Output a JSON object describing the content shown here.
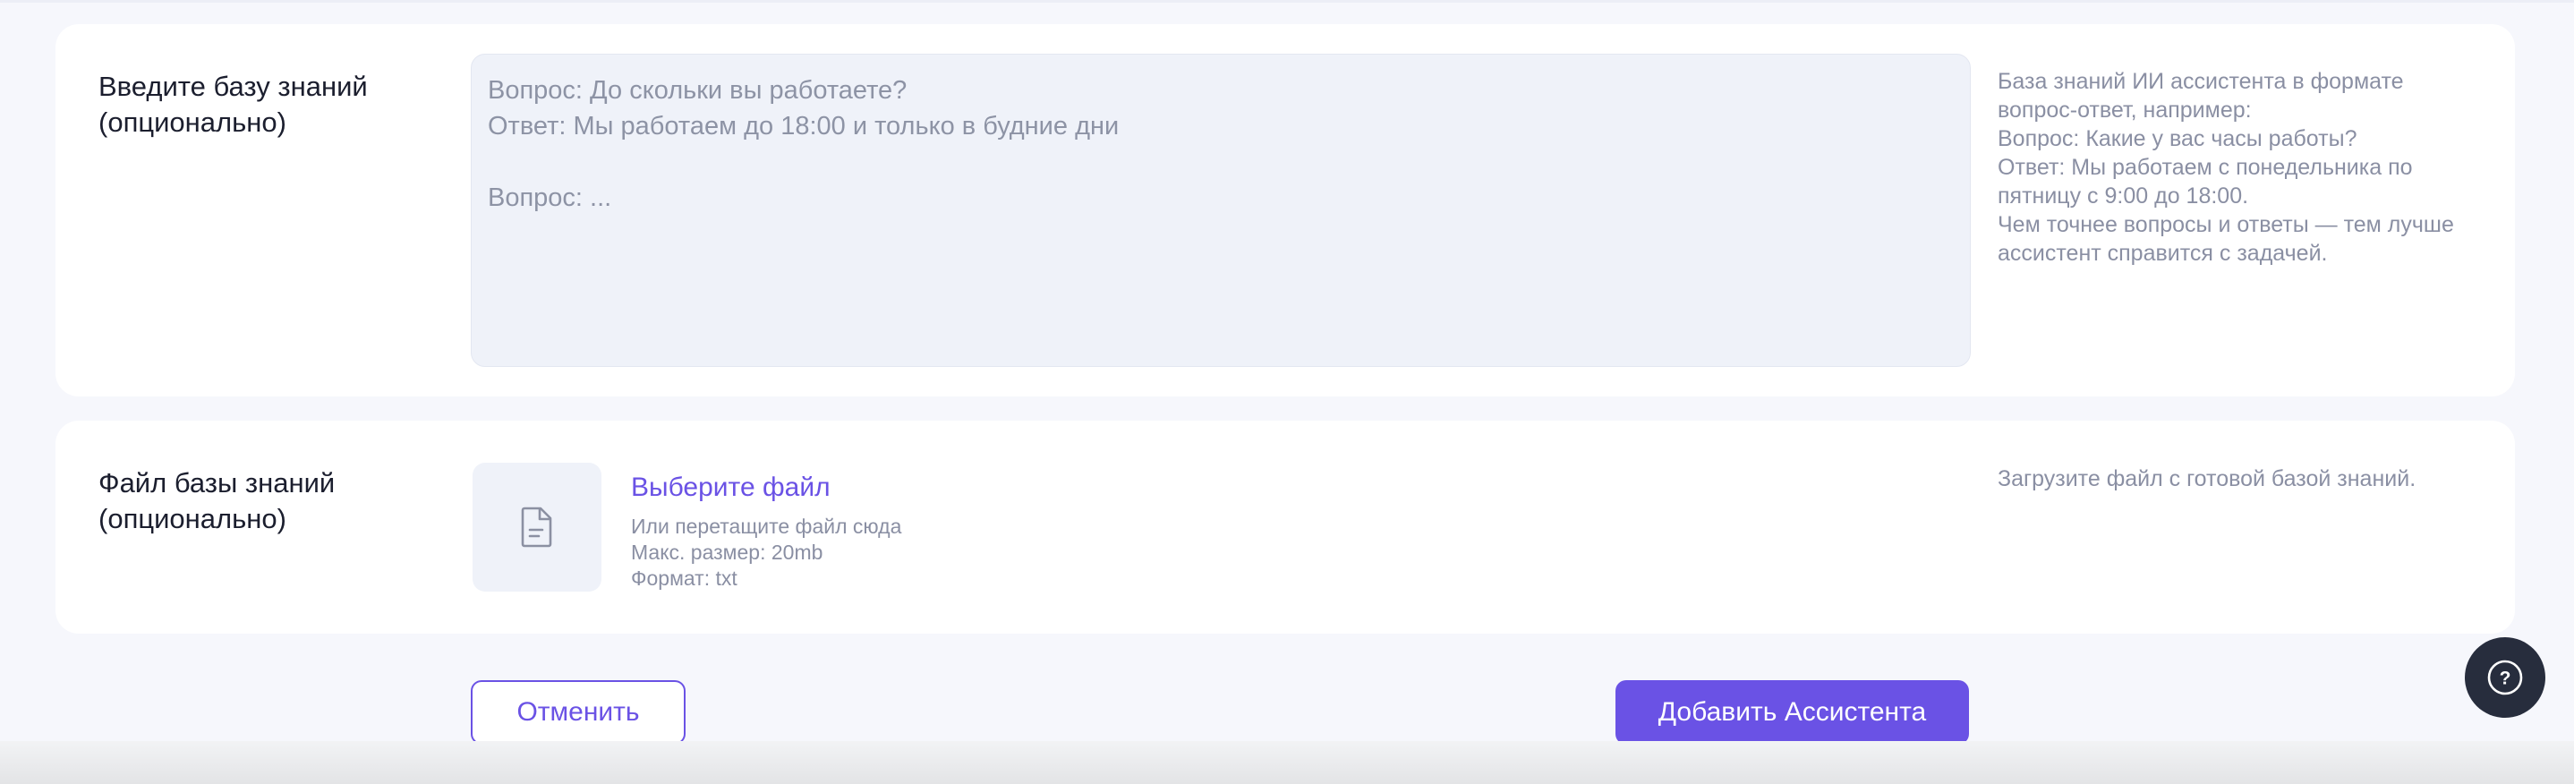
{
  "knowledge_base": {
    "label": "Введите базу знаний (опционально)",
    "textarea_lines": [
      "Вопрос: До скольки вы работаете?",
      "Ответ: Мы работаем до 18:00 и только в будние дни",
      "",
      "Вопрос: ..."
    ],
    "hint_lines": [
      "База знаний ИИ ассистента в формате",
      "вопрос-ответ, например:",
      "Вопрос: Какие у вас часы работы?",
      "Ответ: Мы работаем с понедельника по",
      "пятницу с 9:00 до 18:00.",
      "Чем точнее вопросы и ответы — тем лучше",
      "ассистент справится с задачей."
    ]
  },
  "knowledge_file": {
    "label": "Файл базы знаний (опционально)",
    "icon": "document-icon",
    "choose_file": "Выберите файл",
    "drag_hint": "Или перетащите файл сюда",
    "max_size": "Макс. размер: 20mb",
    "format": "Формат: txt",
    "hint": "Загрузите файл с готовой базой знаний."
  },
  "actions": {
    "cancel": "Отменить",
    "add": "Добавить Ассистента"
  },
  "help": {
    "icon": "question-icon",
    "glyph": "?"
  },
  "colors": {
    "accent": "#6a52e5",
    "help_bg": "#272d3d"
  }
}
